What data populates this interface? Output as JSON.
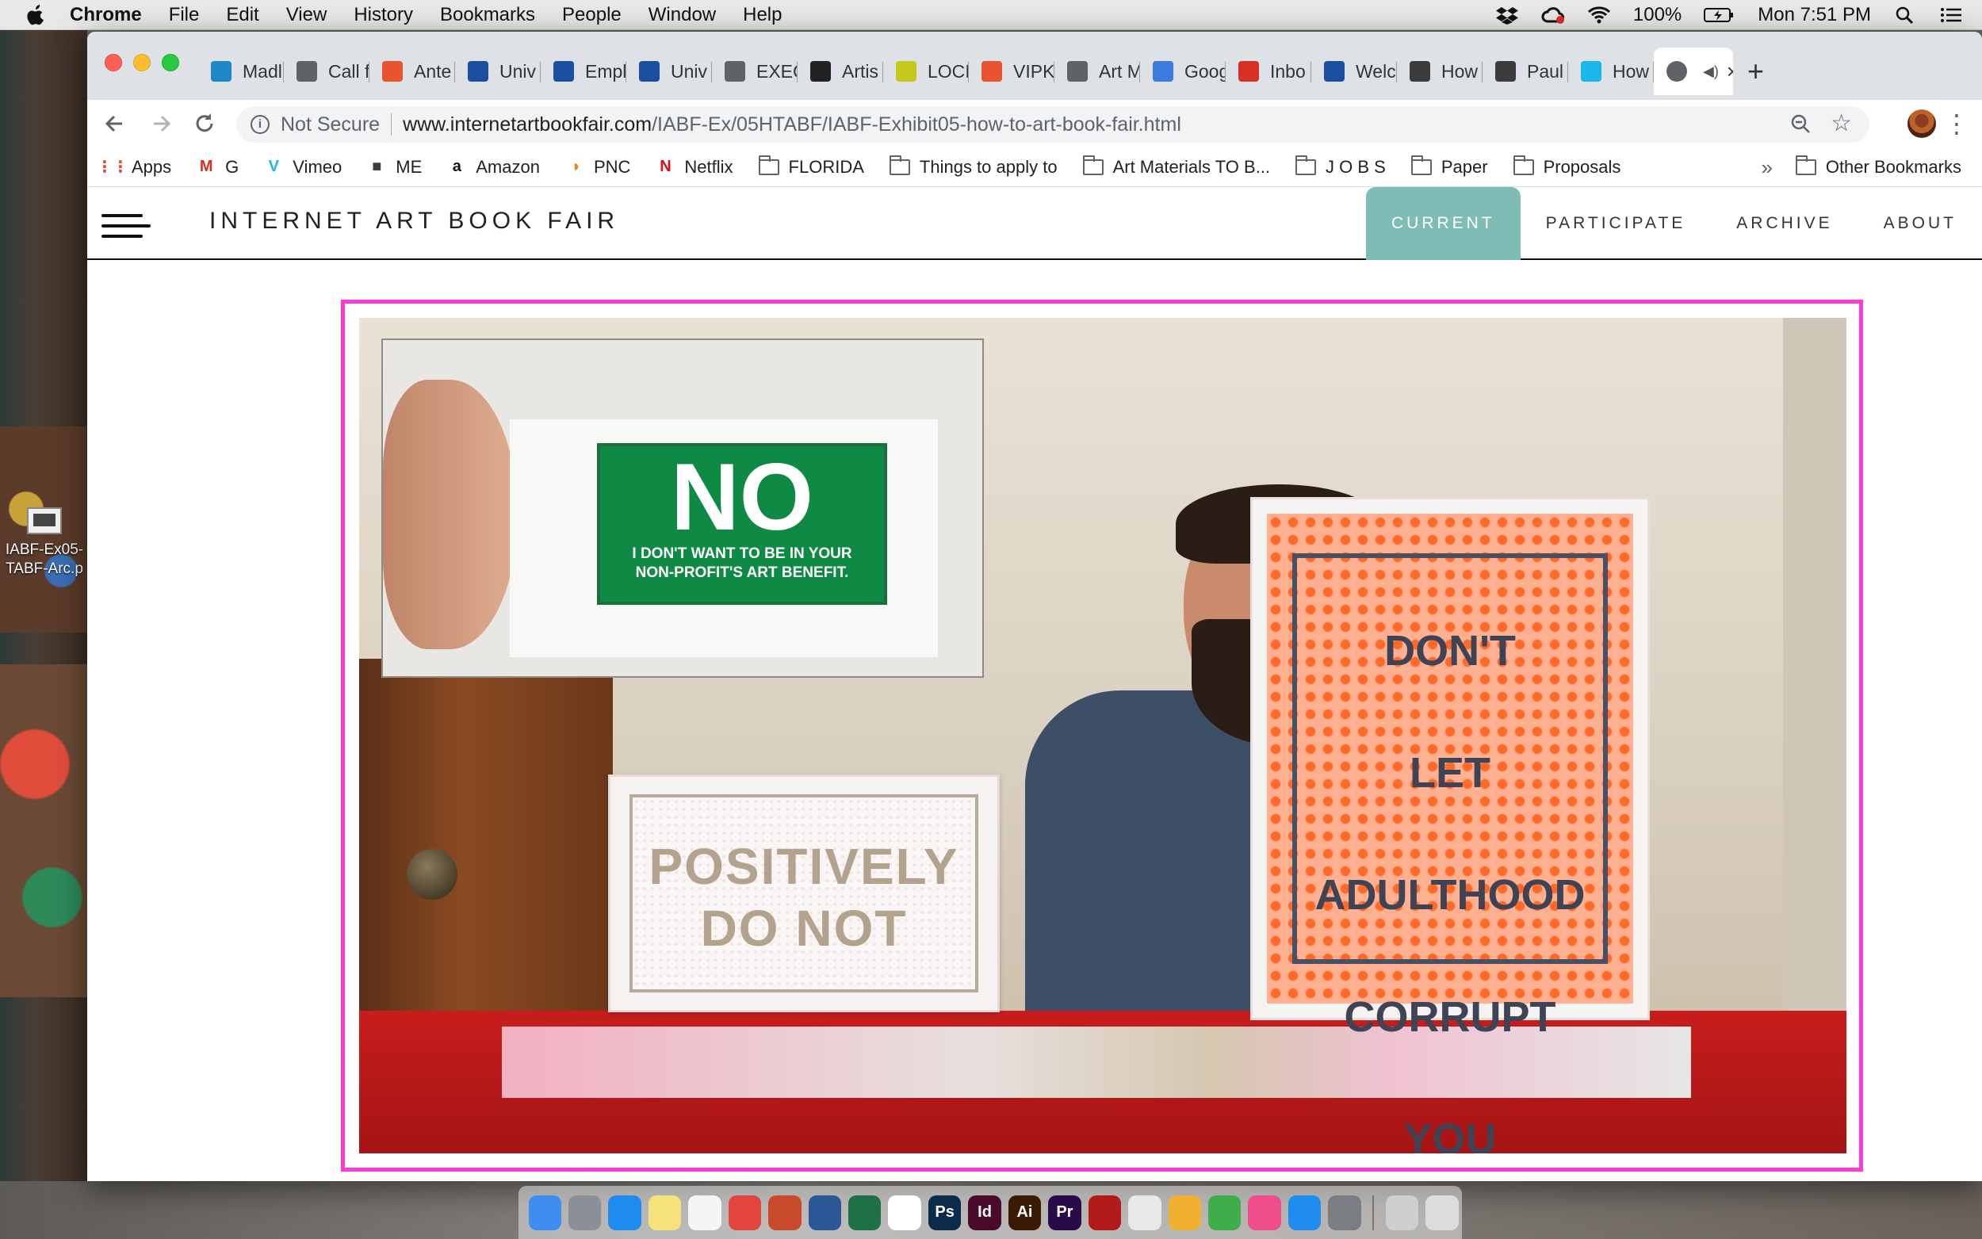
{
  "menubar": {
    "app": "Chrome",
    "items": [
      "File",
      "Edit",
      "View",
      "History",
      "Bookmarks",
      "People",
      "Window",
      "Help"
    ],
    "battery": "100%",
    "clock": "Mon 7:51 PM"
  },
  "desktop": {
    "file_name_line1": "IABF-Ex05-",
    "file_name_line2": "TABF-Arc.p"
  },
  "tabs": [
    {
      "label": "Madl",
      "icon": "tab-favicon",
      "color": "#1e88c9"
    },
    {
      "label": "Call f",
      "icon": "globe-icon",
      "color": "#5f6368"
    },
    {
      "label": "Ante",
      "icon": "tab-favicon",
      "color": "#e8542f"
    },
    {
      "label": "Univ",
      "icon": "uf-icon",
      "color": "#1c4fa0"
    },
    {
      "label": "Empl",
      "icon": "uf-icon",
      "color": "#1c4fa0"
    },
    {
      "label": "Univ",
      "icon": "uf-icon",
      "color": "#1c4fa0"
    },
    {
      "label": "EXEC",
      "icon": "globe-icon",
      "color": "#5f6368"
    },
    {
      "label": "Artis",
      "icon": "t-icon",
      "color": "#222222"
    },
    {
      "label": "LOCI",
      "icon": "tab-favicon",
      "color": "#c5c91c"
    },
    {
      "label": "VIPK",
      "icon": "tab-favicon",
      "color": "#e8542f"
    },
    {
      "label": "Art M",
      "icon": "globe-icon",
      "color": "#5f6368"
    },
    {
      "label": "Goog",
      "icon": "calendar-icon",
      "color": "#3e7be0"
    },
    {
      "label": "Inbo",
      "icon": "gmail-icon",
      "color": "#d93025"
    },
    {
      "label": "Welc",
      "icon": "tab-favicon",
      "color": "#1c4fa0"
    },
    {
      "label": "How",
      "icon": "cube-icon",
      "color": "#3c3c3c"
    },
    {
      "label": "Paul",
      "icon": "cube-icon",
      "color": "#3c3c3c"
    },
    {
      "label": "How",
      "icon": "vimeo-icon",
      "color": "#1ab7ea"
    }
  ],
  "active_tab": {
    "icon": "globe-icon"
  },
  "address": {
    "security": "Not Secure",
    "host": "www.internetartbookfair.com",
    "path": "/IABF-Ex/05HTABF/IABF-Exhibit05-how-to-art-book-fair.html"
  },
  "bookmarks": [
    {
      "label": "Apps",
      "icon": "apps-grid-icon"
    },
    {
      "label": "G",
      "icon": "gmail-icon"
    },
    {
      "label": "Vimeo",
      "icon": "vimeo-icon"
    },
    {
      "label": "ME",
      "icon": "cube-icon"
    },
    {
      "label": "Amazon",
      "icon": "amazon-icon"
    },
    {
      "label": "PNC",
      "icon": "pnc-icon"
    },
    {
      "label": "Netflix",
      "icon": "netflix-icon"
    },
    {
      "label": "FLORIDA",
      "icon": "folder-icon"
    },
    {
      "label": "Things to apply to",
      "icon": "folder-icon"
    },
    {
      "label": "Art Materials TO B...",
      "icon": "folder-icon"
    },
    {
      "label": "J O B S",
      "icon": "folder-icon"
    },
    {
      "label": "Paper",
      "icon": "folder-icon"
    },
    {
      "label": "Proposals",
      "icon": "folder-icon"
    }
  ],
  "bookmarks_more": "»",
  "other_bookmarks": "Other Bookmarks",
  "site": {
    "title": "INTERNET ART BOOK FAIR",
    "nav": [
      "CURRENT",
      "PARTICIPATE",
      "ARCHIVE",
      "ABOUT"
    ],
    "accent": "#7fbcb5",
    "frame_color": "#ff3ad1"
  },
  "video": {
    "sign_no_big": "NO",
    "sign_no_small_1": "I DON'T WANT TO BE IN YOUR",
    "sign_no_small_2": "NON-PROFIT'S ART BENEFIT.",
    "sign_positively_1": "POSITIVELY",
    "sign_positively_2": "DO NOT",
    "sign_adult_1": "DON'T",
    "sign_adult_2": "LET",
    "sign_adult_3": "ADULTHOOD",
    "sign_adult_4": "CORRUPT",
    "sign_adult_5": "YOU"
  },
  "dock": [
    {
      "name": "finder-icon",
      "color": "#3d8ef0"
    },
    {
      "name": "launchpad-icon",
      "color": "#8a8f98"
    },
    {
      "name": "safari-icon",
      "color": "#1f8cf0"
    },
    {
      "name": "notes-icon",
      "color": "#f6e27a"
    },
    {
      "name": "reminders-icon",
      "color": "#f5f5f5"
    },
    {
      "name": "chrome-icon",
      "color": "#e2453c"
    },
    {
      "name": "powerpoint-icon",
      "color": "#c94a2b"
    },
    {
      "name": "word-icon",
      "color": "#2b5797"
    },
    {
      "name": "excel-icon",
      "color": "#1e7145"
    },
    {
      "name": "calendar-icon",
      "color": "#ffffff"
    },
    {
      "name": "photoshop-icon",
      "color": "#0c2b4a",
      "text": "Ps"
    },
    {
      "name": "indesign-icon",
      "color": "#4a0b2a",
      "text": "Id"
    },
    {
      "name": "illustrator-icon",
      "color": "#3a1a02",
      "text": "Ai"
    },
    {
      "name": "premiere-icon",
      "color": "#2a0b4a",
      "text": "Pr"
    },
    {
      "name": "acrobat-icon",
      "color": "#b31b1b"
    },
    {
      "name": "textedit-icon",
      "color": "#e8e8e8"
    },
    {
      "name": "photos-icon",
      "color": "#f0b032"
    },
    {
      "name": "messages-icon",
      "color": "#3fae4a"
    },
    {
      "name": "itunes-icon",
      "color": "#f04e8a"
    },
    {
      "name": "app-store-icon",
      "color": "#1f8cf0"
    },
    {
      "name": "system-preferences-icon",
      "color": "#7a7d82"
    },
    {
      "name": "screenshot-folder-icon",
      "color": "#cfcfcf"
    },
    {
      "name": "trash-icon",
      "color": "#dcdcdc"
    }
  ]
}
